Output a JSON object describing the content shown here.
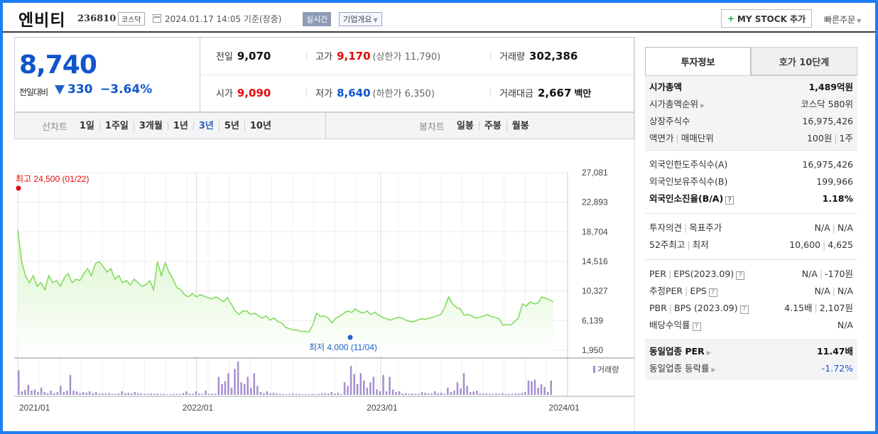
{
  "header": {
    "name": "엔비티",
    "code": "236810",
    "market": "코스닥",
    "datetime": "2024.01.17 14:05  기준(장중)",
    "realtime": "실시간",
    "company_overview": "기업개요",
    "mystock": "MY STOCK 추가",
    "quick_order": "빠른주문"
  },
  "summary": {
    "price": "8,740",
    "change_label": "전일대비",
    "change_value": "330",
    "change_pct": "−3.64%"
  },
  "stats": {
    "prev_label": "전일",
    "prev_value": "9,070",
    "high_label": "고가",
    "high_value": "9,170",
    "upper_limit": "(상한가 11,790)",
    "volume_label": "거래량",
    "volume_value": "302,386",
    "open_label": "시가",
    "open_value": "9,090",
    "low_label": "저가",
    "low_value": "8,640",
    "lower_limit": "(하한가 6,350)",
    "amount_label": "거래대금",
    "amount_value": "2,667",
    "amount_unit": "백만"
  },
  "period_bar": {
    "line_label": "선차트",
    "line_items": [
      "1일",
      "1주일",
      "3개월",
      "1년",
      "3년",
      "5년",
      "10년"
    ],
    "line_selected": "3년",
    "candle_label": "봉차트",
    "candle_items": [
      "일봉",
      "주봉",
      "월봉"
    ]
  },
  "chart_data": {
    "type": "area",
    "x_ticks": [
      "2021/01",
      "2022/01",
      "2023/01",
      "2024/01"
    ],
    "y_ticks": [
      "27,081",
      "22,893",
      "18,704",
      "14,516",
      "10,327",
      "6,139",
      "1,950"
    ],
    "ylim": [
      1950,
      27081
    ],
    "high_annotation": "최고 24,500 (01/22)",
    "low_annotation": "최저 4,000 (11/04)",
    "volume_legend": "거래량",
    "colors": {
      "line": "#7dd957",
      "fill": "#e6f9dd",
      "volume": "#a58fd0",
      "high": "#e00b0b",
      "low": "#1e62c9"
    },
    "series": [
      {
        "values": [
          19000,
          14500,
          12500,
          11500,
          12500,
          11000,
          11500,
          10500,
          12500,
          11500,
          11800,
          11000,
          12200,
          12800,
          11500,
          12000,
          11800,
          12800,
          13500,
          12500,
          14200,
          14500,
          13800,
          13000,
          13500,
          12000,
          12500,
          11500,
          11800,
          11200,
          12000,
          11500,
          11000,
          11200,
          11800,
          10500,
          14500,
          12500,
          14300,
          13000,
          12000,
          10800,
          10500,
          9800,
          9500,
          10000,
          9500,
          9800,
          9600,
          9400,
          9200,
          9500,
          9200,
          8800,
          9400,
          8500,
          7500,
          7000,
          7500,
          7500,
          7000,
          7200,
          6800,
          6500,
          6800,
          6200,
          6500,
          6000,
          5800,
          5200,
          5000,
          4800,
          4800,
          4600,
          4600,
          4500,
          5500,
          7200,
          6700,
          6800,
          6500,
          5800,
          6500,
          6800,
          7200,
          7500,
          7300,
          7800,
          7400,
          7200,
          7500,
          7000,
          7300,
          6900,
          6600,
          6400,
          6200,
          6400,
          6600,
          6500,
          6200,
          6000,
          6000,
          6200,
          6400,
          6300,
          6500,
          6600,
          6800,
          7000,
          8000,
          9500,
          8500,
          8000,
          7800,
          6900,
          7000,
          6800,
          6500,
          6600,
          6800,
          7000,
          6700,
          6600,
          6400,
          5500,
          5600,
          5500,
          6000,
          6500,
          8500,
          8200,
          8800,
          8500,
          8600,
          9500,
          9300,
          9100,
          8800
        ]
      }
    ],
    "volume": [
      68,
      10,
      14,
      28,
      12,
      15,
      8,
      20,
      8,
      5,
      12,
      5,
      8,
      25,
      8,
      12,
      55,
      12,
      10,
      5,
      8,
      6,
      10,
      5,
      8,
      4,
      5,
      4,
      5,
      3,
      3,
      4,
      10,
      5,
      6,
      4,
      8,
      5,
      4,
      3,
      3,
      4,
      3,
      4,
      3,
      3,
      2,
      2,
      3,
      3,
      3,
      5,
      10,
      4,
      3,
      10,
      4,
      3,
      12,
      3,
      4,
      4,
      50,
      30,
      38,
      60,
      20,
      72,
      92,
      35,
      30,
      50,
      20,
      60,
      25,
      8,
      5,
      10,
      5,
      6,
      4,
      3,
      3,
      2,
      3,
      4,
      3,
      3,
      2,
      3,
      2,
      3,
      2,
      3,
      4,
      5,
      4,
      8,
      4,
      6,
      3,
      35,
      25,
      80,
      58,
      30,
      60,
      40,
      20,
      35,
      50,
      15,
      10,
      55,
      10,
      50,
      15,
      8,
      10,
      4,
      5,
      3,
      4,
      3,
      3,
      8,
      6,
      4,
      4,
      10,
      5,
      6,
      3,
      20,
      8,
      12,
      35,
      18,
      60,
      25,
      8,
      10,
      12,
      4,
      4,
      4,
      4,
      3,
      4,
      3,
      5,
      3,
      3,
      3,
      4,
      4,
      6,
      8,
      40,
      38,
      42,
      20,
      30,
      22,
      8,
      40
    ]
  },
  "right_panel": {
    "tab_active": "투자정보",
    "tab_other": "호가 10단계",
    "market_cap_label": "시가총액",
    "market_cap_value": "1,489억원",
    "rank_label": "시가총액순위",
    "rank_value": "코스닥 580위",
    "shares_label": "상장주식수",
    "shares_value": "16,975,426",
    "par_label": "액면가",
    "unit_label": "매매단위",
    "par_value": "100원",
    "unit_value": "1주",
    "foreign_limit_label": "외국인한도주식수(A)",
    "foreign_limit_value": "16,975,426",
    "foreign_hold_label": "외국인보유주식수(B)",
    "foreign_hold_value": "199,966",
    "foreign_ratio_label": "외국인소진율(B/A)",
    "foreign_ratio_value": "1.18%",
    "opinion_label": "투자의견",
    "target_label": "목표주가",
    "opinion_value": "N/A",
    "target_value": "N/A",
    "w52_high_label": "52주최고",
    "w52_low_label": "최저",
    "w52_high_value": "10,600",
    "w52_low_value": "4,625",
    "per_label": "PER",
    "eps_label": "EPS(2023.09)",
    "per_value": "N/A",
    "eps_value": "-170원",
    "est_per_label": "추정PER",
    "est_eps_label": "EPS",
    "est_per_value": "N/A",
    "est_eps_value": "N/A",
    "pbr_label": "PBR",
    "bps_label": "BPS (2023.09)",
    "pbr_value": "4.15배",
    "bps_value": "2,107원",
    "dividend_label": "배당수익률",
    "dividend_value": "N/A",
    "sector_per_label": "동일업종 PER",
    "sector_per_value": "11.47배",
    "sector_rate_label": "동일업종 등락률",
    "sector_rate_value": "-1.72%"
  }
}
